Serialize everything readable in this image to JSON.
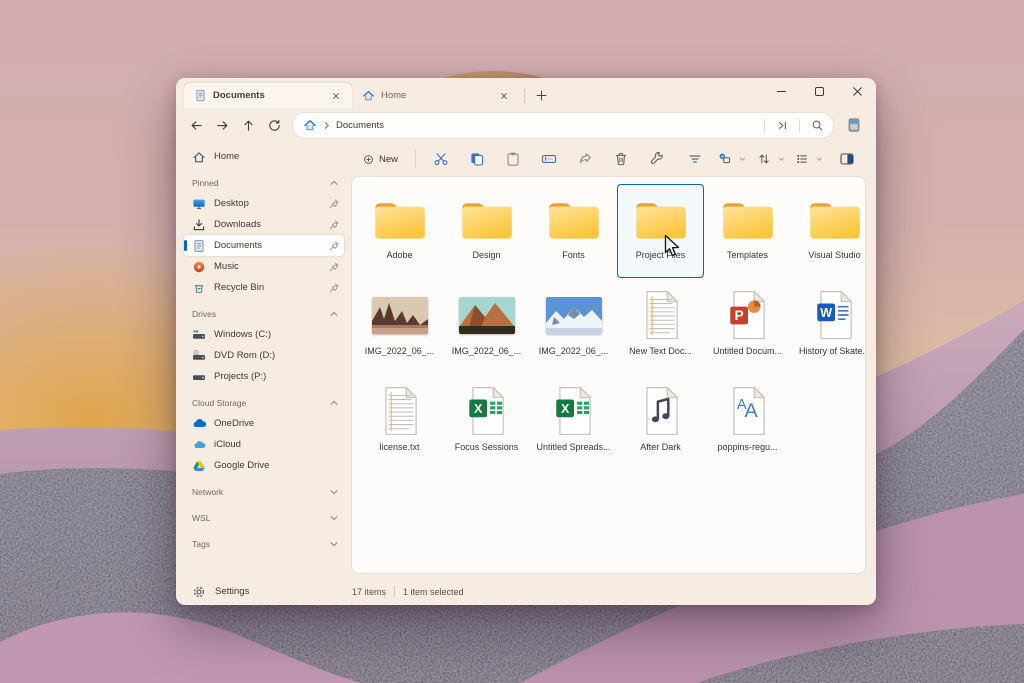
{
  "colors": {
    "accent": "#0067c0",
    "window_bg": "#f7ece2",
    "folder_yellow": "#fdc43e",
    "selection_bg": "#f3f9fd"
  },
  "tabs": [
    {
      "label": "Documents",
      "icon": "document-icon",
      "active": true
    },
    {
      "label": "Home",
      "icon": "home-icon",
      "active": false
    }
  ],
  "navigation": {
    "breadcrumb_root_icon": "home-icon",
    "breadcrumb": "Documents",
    "nav_icons": [
      "back",
      "forward",
      "up",
      "refresh",
      "go-to",
      "search"
    ]
  },
  "toolbar": {
    "new_label": "New",
    "left_icons": [
      "cut",
      "copy",
      "paste",
      "rename",
      "share",
      "delete",
      "properties"
    ],
    "right_icons": [
      "filter",
      "view-options",
      "sort",
      "layout",
      "preview-pane"
    ]
  },
  "sidebar": {
    "home_label": "Home",
    "sections": [
      {
        "label": "Pinned",
        "collapsed": false,
        "items": [
          {
            "label": "Desktop",
            "icon": "desktop-icon",
            "pinned": true
          },
          {
            "label": "Downloads",
            "icon": "download-icon",
            "pinned": true
          },
          {
            "label": "Documents",
            "icon": "document-icon",
            "pinned": true,
            "selected": true
          },
          {
            "label": "Music",
            "icon": "music-disc-icon",
            "pinned": true
          },
          {
            "label": "Recycle Bin",
            "icon": "recycle-bin-icon",
            "pinned": true
          }
        ]
      },
      {
        "label": "Drives",
        "collapsed": false,
        "items": [
          {
            "label": "Windows (C:)",
            "icon": "windows-drive-icon"
          },
          {
            "label": "DVD Rom (D:)",
            "icon": "dvd-drive-icon"
          },
          {
            "label": "Projects (P:)",
            "icon": "drive-icon"
          }
        ]
      },
      {
        "label": "Cloud Storage",
        "collapsed": false,
        "items": [
          {
            "label": "OneDrive",
            "icon": "onedrive-icon"
          },
          {
            "label": "iCloud",
            "icon": "icloud-icon"
          },
          {
            "label": "Google Drive",
            "icon": "google-drive-icon"
          }
        ]
      },
      {
        "label": "Network",
        "collapsed": true,
        "items": []
      },
      {
        "label": "WSL",
        "collapsed": true,
        "items": []
      },
      {
        "label": "Tags",
        "collapsed": true,
        "items": []
      }
    ],
    "settings_label": "Settings"
  },
  "files": {
    "selected_item": "Project Files",
    "items": [
      {
        "name": "Adobe",
        "type": "folder"
      },
      {
        "name": "Design",
        "type": "folder"
      },
      {
        "name": "Fonts",
        "type": "folder"
      },
      {
        "name": "Project Files",
        "type": "folder",
        "selected": true
      },
      {
        "name": "Templates",
        "type": "folder"
      },
      {
        "name": "Visual Studio",
        "type": "folder"
      },
      {
        "name": "IMG_2022_06_...",
        "type": "image"
      },
      {
        "name": "IMG_2022_06_...",
        "type": "image"
      },
      {
        "name": "IMG_2022_06_...",
        "type": "image"
      },
      {
        "name": "New Text Doc...",
        "type": "text"
      },
      {
        "name": "Untitled Docum...",
        "type": "powerpoint"
      },
      {
        "name": "History of Skate...",
        "type": "word"
      },
      {
        "name": "license.txt",
        "type": "text"
      },
      {
        "name": "Focus Sessions",
        "type": "excel"
      },
      {
        "name": "Untitled Spreads...",
        "type": "excel"
      },
      {
        "name": "After Dark",
        "type": "audio"
      },
      {
        "name": "poppins-regu...",
        "type": "font"
      }
    ]
  },
  "status_bar": {
    "count": "17 items",
    "selected": "1 item selected"
  }
}
